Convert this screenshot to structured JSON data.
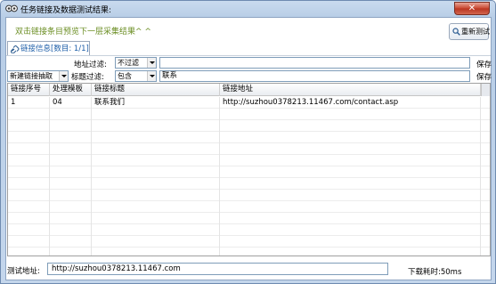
{
  "window": {
    "title": "任务链接及数据测试结果:",
    "close_label": "✕"
  },
  "hint": "双击链接条目预览下一层采集结果^ ^",
  "retest_button": "重新测试",
  "tab": {
    "label": "链接信息[数目: 1/1]"
  },
  "filters": {
    "address_label": "地址过滤:",
    "address_mode": "不过滤",
    "address_value": "",
    "title_label": "标题过滤:",
    "title_mode": "包含",
    "title_value": "联系",
    "extract_rule": "新建链接抽取",
    "save_label_1": "保存",
    "save_label_2": "保存"
  },
  "table": {
    "columns": [
      "链接序号",
      "处理模板",
      "链接标题",
      "链接地址"
    ],
    "rows": [
      [
        "1",
        "04",
        "联系我们",
        "http://suzhou0378213.11467.com/contact.asp"
      ]
    ]
  },
  "footer": {
    "test_url_label": "测试地址:",
    "test_url_value": "http://suzhou0378213.11467.com",
    "elapsed": "下载耗时:50ms"
  },
  "colors": {
    "hint": "#6b8e23",
    "tab_text": "#1d5ea8",
    "close_button": "#c9462f"
  }
}
